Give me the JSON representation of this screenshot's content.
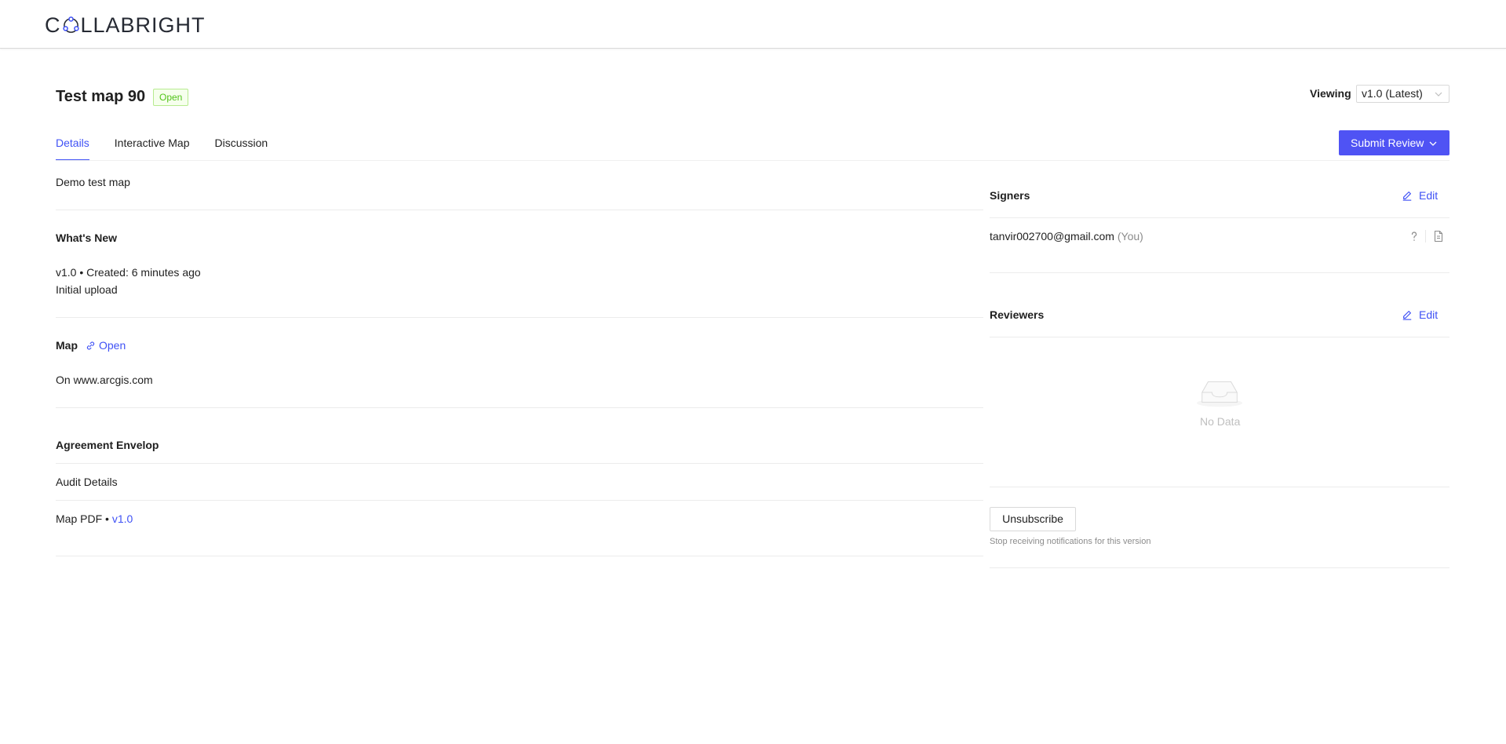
{
  "header": {
    "logo_text_left": "C",
    "logo_text_right": "LLABRIGHT"
  },
  "page": {
    "title": "Test map 90",
    "status": "Open"
  },
  "viewing": {
    "label": "Viewing",
    "selected": "v1.0 (Latest)"
  },
  "tabs": [
    {
      "label": "Details",
      "active": true
    },
    {
      "label": "Interactive Map",
      "active": false
    },
    {
      "label": "Discussion",
      "active": false
    }
  ],
  "actions": {
    "submit_review": "Submit Review"
  },
  "details": {
    "description": "Demo test map",
    "whats_new": {
      "heading": "What's New",
      "version_line": "v1.0 • Created: 6 minutes ago",
      "note": "Initial upload"
    },
    "map": {
      "heading": "Map",
      "open_link": "Open",
      "source": "On www.arcgis.com"
    },
    "agreement": {
      "heading": "Agreement Envelop",
      "audit": "Audit Details",
      "map_pdf_label": "Map PDF •",
      "map_pdf_version": "v1.0"
    }
  },
  "signers": {
    "heading": "Signers",
    "edit": "Edit",
    "items": [
      {
        "email": "tanvir002700@gmail.com",
        "suffix": "(You)"
      }
    ]
  },
  "reviewers": {
    "heading": "Reviewers",
    "edit": "Edit",
    "empty_text": "No Data"
  },
  "subscription": {
    "button": "Unsubscribe",
    "help": "Stop receiving notifications for this version"
  },
  "colors": {
    "primary": "#4f53f4",
    "link": "#3f51f5",
    "success": "#52c41a"
  }
}
